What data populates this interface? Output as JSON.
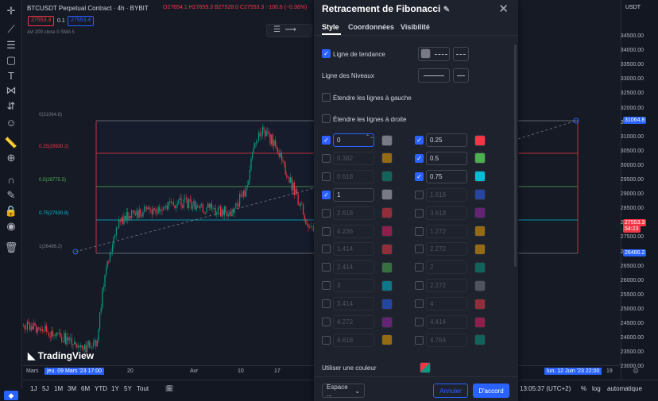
{
  "header": {
    "symbol": "BTCUSDT Perpetual Contract · 4h · BYBIT",
    "ohlc": "O27654.1 H27659.3 B27528.0 C27553.3 −100.6 (−0.36%)",
    "sell_price": "27553.3",
    "spread": "0.1",
    "buy_price": "27553.4",
    "indicator": "Avl 200 close 0 SMA 5"
  },
  "fib_levels": [
    {
      "label": "0(31064.8)"
    },
    {
      "label": "0.25(29930.2)"
    },
    {
      "label": "0.5(28775.5)"
    },
    {
      "label": "0.75(27630.8)"
    },
    {
      "label": "1(26486.2)"
    }
  ],
  "watermark": "TradingView",
  "price_axis": {
    "currency": "USDT",
    "ticks": [
      "34500.00",
      "34000.00",
      "33500.00",
      "33000.00",
      "32500.00",
      "32000.00",
      "31500.00",
      "31000.00",
      "30500.00",
      "30000.00",
      "29500.00",
      "29000.00",
      "28500.00",
      "28000.00",
      "27500.00",
      "27000.00",
      "26500.00",
      "26000.00",
      "25500.00",
      "25000.00",
      "24500.00",
      "24000.00",
      "23500.00",
      "23000.00"
    ],
    "tag_top": "31064.8",
    "tag_current": "27553.3",
    "tag_countdown": "54:23",
    "tag_bottom": "26486.2"
  },
  "time_axis": {
    "labels": [
      "Mars",
      "20",
      "Avr",
      "10",
      "17",
      "19"
    ],
    "cursor_start": "jeu. 09 Mars '23  17:00",
    "cursor_end": "lun. 12 Juin '23  22:00"
  },
  "bottom": {
    "ranges": [
      "1J",
      "5J",
      "1M",
      "3M",
      "6M",
      "YTD",
      "1Y",
      "5Y",
      "Tout"
    ],
    "clock": "13:05:37 (UTC+2)",
    "pct": "%",
    "log": "log",
    "auto": "automatique"
  },
  "dialog": {
    "title": "Retracement de Fibonacci",
    "tabs": [
      "Style",
      "Coordonnées",
      "Visibilité"
    ],
    "trend_line": "Ligne de tendance",
    "levels_line": "Ligne des Niveaux",
    "extend_left": "Étendre les lignes à gauche",
    "extend_right": "Étendre les lignes à droite",
    "use_one_color": "Utiliser une couleur",
    "template": "Espace ...",
    "cancel": "Annuler",
    "ok": "D'accord",
    "levels_left": [
      {
        "v": "0",
        "on": true,
        "c": "#787b86"
      },
      {
        "v": "0.382",
        "on": false,
        "c": "#f7a600"
      },
      {
        "v": "0.618",
        "on": false,
        "c": "#089981"
      },
      {
        "v": "1",
        "on": true,
        "c": "#787b86"
      },
      {
        "v": "2.618",
        "on": false,
        "c": "#f23645"
      },
      {
        "v": "4.236",
        "on": false,
        "c": "#e91e63"
      },
      {
        "v": "1.414",
        "on": false,
        "c": "#f23645"
      },
      {
        "v": "2.414",
        "on": false,
        "c": "#4caf50"
      },
      {
        "v": "3",
        "on": false,
        "c": "#00bcd4"
      },
      {
        "v": "3.414",
        "on": false,
        "c": "#2962ff"
      },
      {
        "v": "4.272",
        "on": false,
        "c": "#9c27b0"
      },
      {
        "v": "4.618",
        "on": false,
        "c": "#f7a600"
      }
    ],
    "levels_right": [
      {
        "v": "0.25",
        "on": true,
        "c": "#f23645"
      },
      {
        "v": "0.5",
        "on": true,
        "c": "#4caf50"
      },
      {
        "v": "0.75",
        "on": true,
        "c": "#00bcd4"
      },
      {
        "v": "1.618",
        "on": false,
        "c": "#2962ff"
      },
      {
        "v": "3.618",
        "on": false,
        "c": "#9c27b0"
      },
      {
        "v": "1.272",
        "on": false,
        "c": "#f7a600"
      },
      {
        "v": "2.272",
        "on": false,
        "c": "#f7a600"
      },
      {
        "v": "2",
        "on": false,
        "c": "#089981"
      },
      {
        "v": "2.272",
        "on": false,
        "c": "#787b86"
      },
      {
        "v": "4",
        "on": false,
        "c": "#f23645"
      },
      {
        "v": "4.414",
        "on": false,
        "c": "#e91e63"
      },
      {
        "v": "4.764",
        "on": false,
        "c": "#089981"
      }
    ]
  }
}
